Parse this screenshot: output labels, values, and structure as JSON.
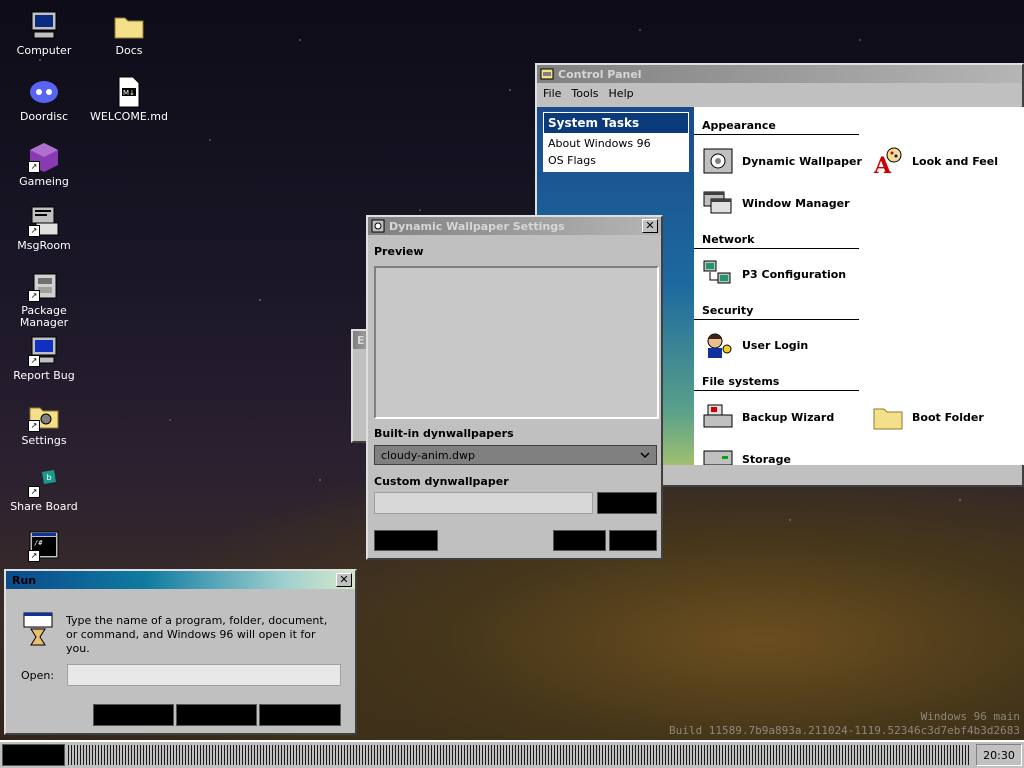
{
  "desktop": {
    "icons": [
      {
        "label": "Computer",
        "icon": "computer-icon"
      },
      {
        "label": "Docs",
        "icon": "folder-icon"
      },
      {
        "label": "Doordisc",
        "icon": "doordisc-icon"
      },
      {
        "label": "WELCOME.md",
        "icon": "markdown-file-icon"
      },
      {
        "label": "Gameing",
        "icon": "game-cube-icon"
      },
      {
        "label": "MsgRoom",
        "icon": "msgroom-icon"
      },
      {
        "label": "Package Manager",
        "icon": "package-manager-icon"
      },
      {
        "label": "Report Bug",
        "icon": "report-bug-icon"
      },
      {
        "label": "Settings",
        "icon": "settings-icon"
      },
      {
        "label": "Share Board",
        "icon": "share-board-icon"
      },
      {
        "label": "",
        "icon": "terminal-icon"
      }
    ]
  },
  "control_panel": {
    "title": "Control Panel",
    "menu": [
      "File",
      "Tools",
      "Help"
    ],
    "tasks_title": "System Tasks",
    "tasks": [
      "About Windows 96",
      "OS Flags"
    ],
    "sections": [
      {
        "title": "Appearance",
        "items": [
          "Dynamic Wallpaper",
          "Look and Feel",
          "Window Manager"
        ]
      },
      {
        "title": "Network",
        "items": [
          "P3 Configuration"
        ]
      },
      {
        "title": "Security",
        "items": [
          "User Login"
        ]
      },
      {
        "title": "File systems",
        "items": [
          "Backup Wizard",
          "Boot Folder",
          "Storage"
        ]
      }
    ]
  },
  "background_window": {
    "title_initial": "E"
  },
  "dynwall": {
    "title": "Dynamic Wallpaper Settings",
    "preview_label": "Preview",
    "builtin_label": "Built-in dynwallpapers",
    "builtin_selected": "cloudy-anim.dwp",
    "custom_label": "Custom dynwallpaper",
    "custom_value": ""
  },
  "run": {
    "title": "Run",
    "description": "Type the name of a program, folder, document, or command, and Windows 96 will open it for you.",
    "open_label": "Open:",
    "open_value": ""
  },
  "watermark": {
    "line1": "Windows 96 main",
    "line2": "Build 11589.7b9a893a.211024-1119.52346c3d7ebf4b3d2683"
  },
  "taskbar": {
    "clock": "20:30"
  }
}
